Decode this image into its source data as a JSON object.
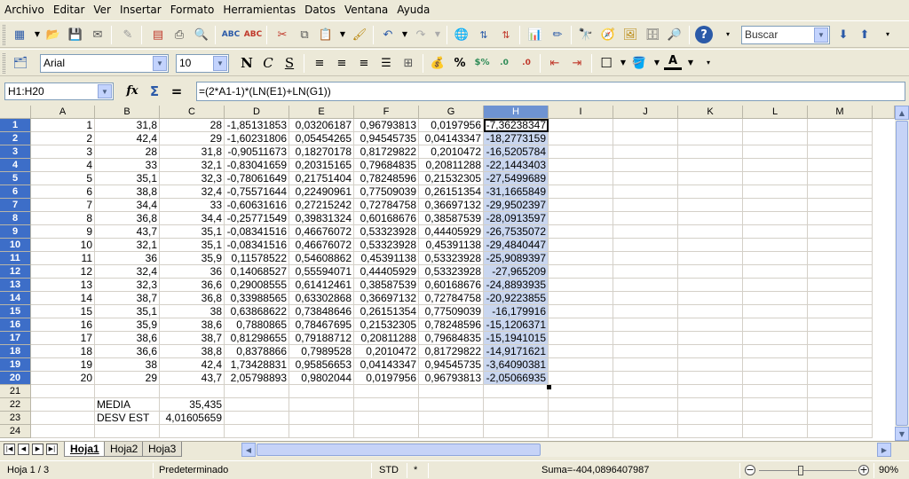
{
  "menubar": [
    "Archivo",
    "Editar",
    "Ver",
    "Insertar",
    "Formato",
    "Herramientas",
    "Datos",
    "Ventana",
    "Ayuda"
  ],
  "toolbar1": {
    "search_placeholder": "Buscar"
  },
  "toolbar2": {
    "font_name": "Arial",
    "font_size": "10"
  },
  "formula_bar": {
    "name_box": "H1:H20",
    "formula": "=(2*A1-1)*(LN(E1)+LN(G1))"
  },
  "grid": {
    "columns": [
      "A",
      "B",
      "C",
      "D",
      "E",
      "F",
      "G",
      "H",
      "I",
      "J",
      "K",
      "L",
      "M"
    ],
    "selected_column": "H",
    "rows": [
      [
        "1",
        "31,8",
        "28",
        "-1,85131853",
        "0,03206187",
        "0,96793813",
        "0,0197956",
        "-7,36238347"
      ],
      [
        "2",
        "42,4",
        "29",
        "-1,60231806",
        "0,05454265",
        "0,94545735",
        "0,04143347",
        "-18,2773159"
      ],
      [
        "3",
        "28",
        "31,8",
        "-0,90511673",
        "0,18270178",
        "0,81729822",
        "0,2010472",
        "-16,5205784"
      ],
      [
        "4",
        "33",
        "32,1",
        "-0,83041659",
        "0,20315165",
        "0,79684835",
        "0,20811288",
        "-22,1443403"
      ],
      [
        "5",
        "35,1",
        "32,3",
        "-0,78061649",
        "0,21751404",
        "0,78248596",
        "0,21532305",
        "-27,5499689"
      ],
      [
        "6",
        "38,8",
        "32,4",
        "-0,75571644",
        "0,22490961",
        "0,77509039",
        "0,26151354",
        "-31,1665849"
      ],
      [
        "7",
        "34,4",
        "33",
        "-0,60631616",
        "0,27215242",
        "0,72784758",
        "0,36697132",
        "-29,9502397"
      ],
      [
        "8",
        "36,8",
        "34,4",
        "-0,25771549",
        "0,39831324",
        "0,60168676",
        "0,38587539",
        "-28,0913597"
      ],
      [
        "9",
        "43,7",
        "35,1",
        "-0,08341516",
        "0,46676072",
        "0,53323928",
        "0,44405929",
        "-26,7535072"
      ],
      [
        "10",
        "32,1",
        "35,1",
        "-0,08341516",
        "0,46676072",
        "0,53323928",
        "0,45391138",
        "-29,4840447"
      ],
      [
        "11",
        "36",
        "35,9",
        "0,11578522",
        "0,54608862",
        "0,45391138",
        "0,53323928",
        "-25,9089397"
      ],
      [
        "12",
        "32,4",
        "36",
        "0,14068527",
        "0,55594071",
        "0,44405929",
        "0,53323928",
        "-27,965209"
      ],
      [
        "13",
        "32,3",
        "36,6",
        "0,29008555",
        "0,61412461",
        "0,38587539",
        "0,60168676",
        "-24,8893935"
      ],
      [
        "14",
        "38,7",
        "36,8",
        "0,33988565",
        "0,63302868",
        "0,36697132",
        "0,72784758",
        "-20,9223855"
      ],
      [
        "15",
        "35,1",
        "38",
        "0,63868622",
        "0,73848646",
        "0,26151354",
        "0,77509039",
        "-16,179916"
      ],
      [
        "16",
        "35,9",
        "38,6",
        "0,7880865",
        "0,78467695",
        "0,21532305",
        "0,78248596",
        "-15,1206371"
      ],
      [
        "17",
        "38,6",
        "38,7",
        "0,81298655",
        "0,79188712",
        "0,20811288",
        "0,79684835",
        "-15,1941015"
      ],
      [
        "18",
        "36,6",
        "38,8",
        "0,8378866",
        "0,7989528",
        "0,2010472",
        "0,81729822",
        "-14,9171621"
      ],
      [
        "19",
        "38",
        "42,4",
        "1,73428831",
        "0,95856653",
        "0,04143347",
        "0,94545735",
        "-3,64090381"
      ],
      [
        "20",
        "29",
        "43,7",
        "2,05798893",
        "0,9802044",
        "0,0197956",
        "0,96793813",
        "-2,05066935"
      ]
    ],
    "row_numbers": [
      "1",
      "2",
      "3",
      "4",
      "5",
      "6",
      "7",
      "8",
      "9",
      "10",
      "11",
      "12",
      "13",
      "14",
      "15",
      "16",
      "17",
      "18",
      "19",
      "20",
      "21",
      "22",
      "23",
      "24"
    ],
    "media_label": "MEDIA",
    "media_value": "35,435",
    "desv_label": "DESV EST",
    "desv_value": "4,01605659"
  },
  "sheet_tabs": [
    "Hoja1",
    "Hoja2",
    "Hoja3"
  ],
  "statusbar": {
    "sheet": "Hoja 1 / 3",
    "style": "Predeterminado",
    "mode": "STD",
    "modified": "*",
    "sum": "Suma=-404,0896407987",
    "zoom": "90%"
  }
}
